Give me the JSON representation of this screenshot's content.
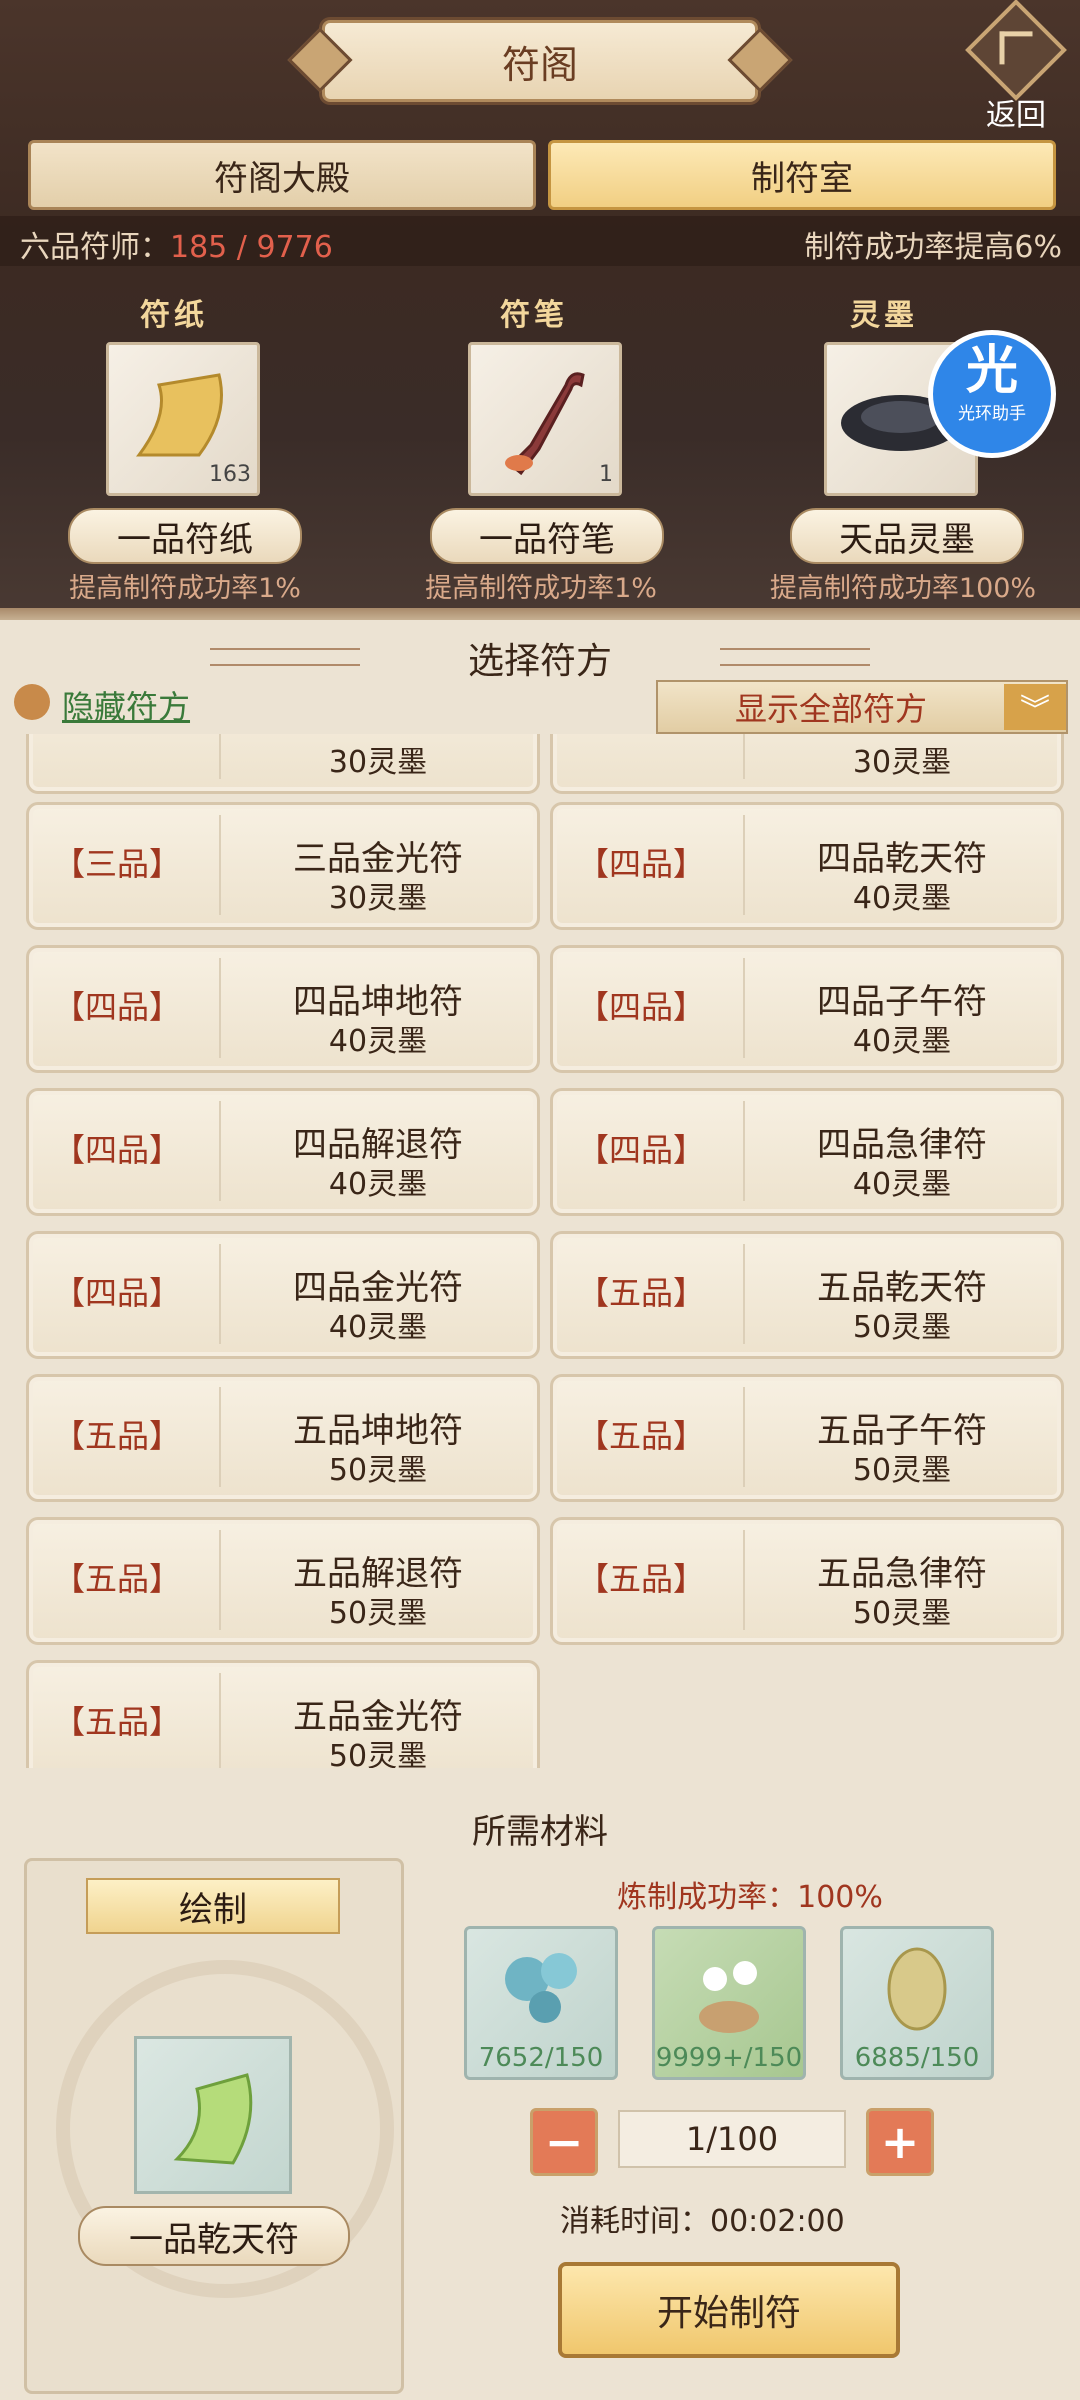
{
  "header": {
    "title": "符阁",
    "back_label": "返回"
  },
  "tabs": [
    {
      "label": "符阁大殿"
    },
    {
      "label": "制符室"
    }
  ],
  "status": {
    "rank_prefix": "六品符师：",
    "progress_current": "185",
    "progress_sep": " / ",
    "progress_total": "9776",
    "bonus": "制符成功率提高6%"
  },
  "materials": [
    {
      "category": "符纸",
      "name": "一品符纸",
      "count": "163",
      "effect": "提高制符成功率1%"
    },
    {
      "category": "符笔",
      "name": "一品符笔",
      "count": "1",
      "effect": "提高制符成功率1%"
    },
    {
      "category": "灵墨",
      "name": "天品灵墨",
      "count": "",
      "effect": "提高制符成功率100%"
    }
  ],
  "helper": {
    "big": "光",
    "small": "光环助手"
  },
  "recipes": {
    "section_title": "选择符方",
    "hide_link": "隐藏符方",
    "filter": "显示全部符方",
    "items": [
      {
        "grade": "",
        "name": "",
        "cost": "30灵墨"
      },
      {
        "grade": "",
        "name": "",
        "cost": "30灵墨"
      },
      {
        "grade": "【三品】",
        "name": "三品金光符",
        "cost": "30灵墨"
      },
      {
        "grade": "【四品】",
        "name": "四品乾天符",
        "cost": "40灵墨"
      },
      {
        "grade": "【四品】",
        "name": "四品坤地符",
        "cost": "40灵墨"
      },
      {
        "grade": "【四品】",
        "name": "四品子午符",
        "cost": "40灵墨"
      },
      {
        "grade": "【四品】",
        "name": "四品解退符",
        "cost": "40灵墨"
      },
      {
        "grade": "【四品】",
        "name": "四品急律符",
        "cost": "40灵墨"
      },
      {
        "grade": "【四品】",
        "name": "四品金光符",
        "cost": "40灵墨"
      },
      {
        "grade": "【五品】",
        "name": "五品乾天符",
        "cost": "50灵墨"
      },
      {
        "grade": "【五品】",
        "name": "五品坤地符",
        "cost": "50灵墨"
      },
      {
        "grade": "【五品】",
        "name": "五品子午符",
        "cost": "50灵墨"
      },
      {
        "grade": "【五品】",
        "name": "五品解退符",
        "cost": "50灵墨"
      },
      {
        "grade": "【五品】",
        "name": "五品急律符",
        "cost": "50灵墨"
      },
      {
        "grade": "【五品】",
        "name": "五品金光符",
        "cost": "50灵墨"
      }
    ]
  },
  "required": {
    "title": "所需材料",
    "draw_label": "绘制",
    "target_name": "一品乾天符",
    "success_rate": "炼制成功率：100%",
    "herbs": [
      {
        "count": "7652/150",
        "color": "#5a9fb0"
      },
      {
        "count": "9999+/150",
        "color": "#6e9e5a"
      },
      {
        "count": "6885/150",
        "color": "#c9b46a"
      }
    ],
    "minus": "−",
    "plus": "+",
    "quantity": "1/100",
    "time": "消耗时间：00:02:00",
    "start": "开始制符"
  }
}
